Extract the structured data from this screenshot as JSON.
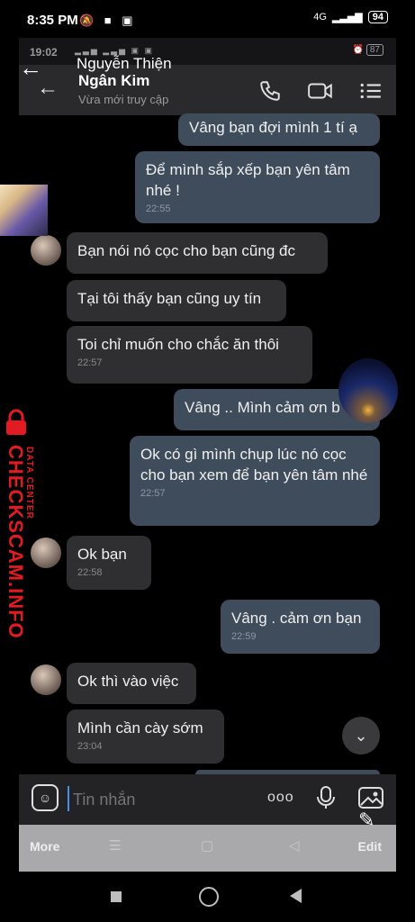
{
  "outer_status": {
    "time": "8:35 PM",
    "battery": "94",
    "net": "4G"
  },
  "inner_status": {
    "time": "19:02",
    "battery": "87"
  },
  "overlay_contact": "Nguyễn Thiện",
  "header": {
    "name": "Ngân Kim",
    "subtitle": "Vừa mới truy cập"
  },
  "messages": [
    {
      "text": "Vâng bạn đợi mình 1 tí ạ",
      "time": ""
    },
    {
      "text": "Để mình sắp xếp bạn yên tâm nhé !",
      "time": "22:55"
    },
    {
      "text": "Bạn nói nó cọc cho bạn cũng đc",
      "time": ""
    },
    {
      "text": "Tại tôi thấy bạn cũng uy tín",
      "time": ""
    },
    {
      "text": "Toi chỉ muốn cho chắc ăn thôi",
      "time": "22:57"
    },
    {
      "text": "Vâng .. Mình cảm ơn b",
      "time": ""
    },
    {
      "text": "Ok có gì mình chụp lúc nó cọc cho bạn xem để bạn yên tâm nhé",
      "time": "22:57"
    },
    {
      "text": "Ok bạn",
      "time": "22:58"
    },
    {
      "text": "Vâng . cảm ơn bạn",
      "time": "22:59"
    },
    {
      "text": "Ok thì vào việc",
      "time": ""
    },
    {
      "text": "Mình cần cày sớm",
      "time": "23:04"
    }
  ],
  "input": {
    "placeholder": "Tin nhắn",
    "more": "ooo"
  },
  "edit_bar": {
    "more": "More",
    "edit": "Edit"
  },
  "watermark": {
    "brand": "CHECKSCAM.INFO",
    "sub": "DATA CENTER"
  }
}
